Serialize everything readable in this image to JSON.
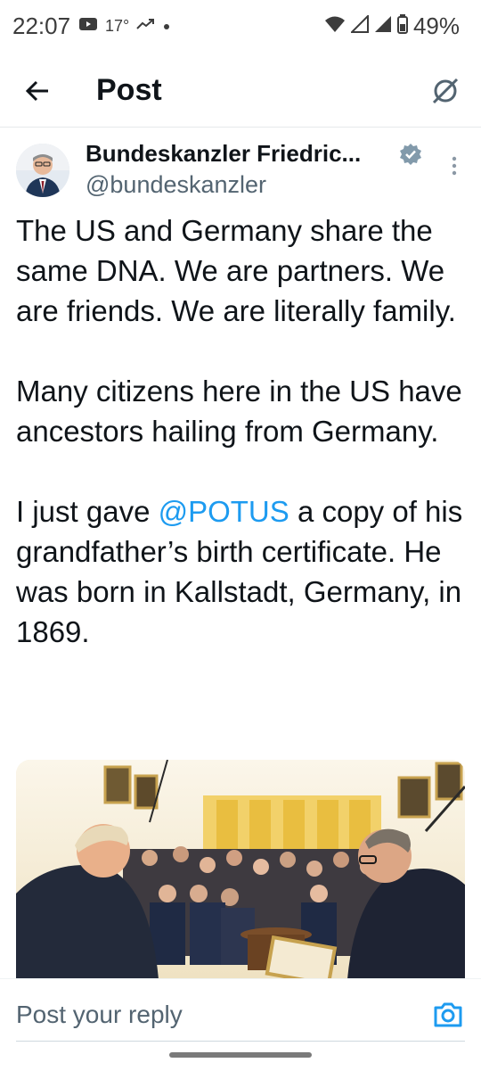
{
  "status_bar": {
    "time": "22:07",
    "temperature": "17°",
    "battery": "49%"
  },
  "header": {
    "title": "Post"
  },
  "post": {
    "author_name": "Bundeskanzler Friedric...",
    "author_handle": "@bundeskanzler",
    "verified": true,
    "paragraph1": "The US and Germany share the same DNA. We are partners. We are friends. We are literally family.",
    "paragraph2": "Many citizens here in the US have ancestors hailing from Germany.",
    "paragraph3_before": "I just gave ",
    "paragraph3_mention": "@POTUS",
    "paragraph3_after": " a copy of his grandfather’s birth certificate. He was born in Kallstadt, Germany, in 1869."
  },
  "reply": {
    "placeholder": "Post your reply"
  },
  "colors": {
    "accent": "#1d9bf0",
    "text_primary": "#0f1419",
    "text_secondary": "#536471"
  },
  "icons": [
    "back-arrow-icon",
    "grok-icon",
    "verified-icon",
    "more-vertical-icon",
    "camera-icon",
    "video-icon",
    "trend-icon",
    "wifi-icon",
    "signal-icon",
    "battery-icon"
  ]
}
